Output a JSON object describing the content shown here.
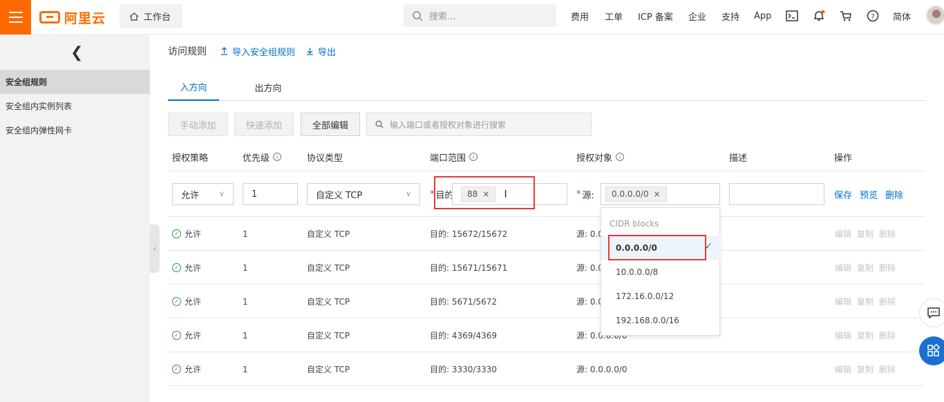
{
  "topbar": {
    "brand": "阿里云",
    "workbench": "工作台",
    "search_placeholder": "搜索...",
    "nav": [
      "费用",
      "工单",
      "ICP 备案",
      "企业",
      "支持",
      "App"
    ],
    "lang": "简体"
  },
  "sidebar": {
    "items": [
      "安全组规则",
      "安全组内实例列表",
      "安全组内弹性网卡"
    ]
  },
  "main": {
    "title": "访问规则",
    "import_link": "导入安全组规则",
    "export_link": "导出",
    "tabs": [
      "入方向",
      "出方向"
    ],
    "buttons": {
      "manual_add": "手动添加",
      "quick_add": "快速添加",
      "batch_edit": "全部编辑"
    },
    "table_search_placeholder": "输入端口或者授权对象进行搜索",
    "columns": [
      "授权策略",
      "优先级",
      "协议类型",
      "端口范围",
      "授权对象",
      "描述",
      "操作"
    ],
    "edit_row": {
      "policy": "允许",
      "priority": "1",
      "protocol": "自定义 TCP",
      "port_label": "目的:",
      "port_tag": "88",
      "source_label": "源:",
      "source_tag": "0.0.0.0/0",
      "save": "保存",
      "preview": "预览",
      "delete": "删除"
    },
    "rows": [
      {
        "policy": "允许",
        "priority": "1",
        "protocol": "自定义 TCP",
        "port": "目的: 15672/15672",
        "source": "源: 0.0.0.0/0"
      },
      {
        "policy": "允许",
        "priority": "1",
        "protocol": "自定义 TCP",
        "port": "目的: 15671/15671",
        "source": "源: 0.0.0.0/0"
      },
      {
        "policy": "允许",
        "priority": "1",
        "protocol": "自定义 TCP",
        "port": "目的: 5671/5672",
        "source": "源: 0.0.0.0/0"
      },
      {
        "policy": "允许",
        "priority": "1",
        "protocol": "自定义 TCP",
        "port": "目的: 4369/4369",
        "source": "源: 0.0.0.0/0"
      },
      {
        "policy": "允许",
        "priority": "1",
        "protocol": "自定义 TCP",
        "port": "目的: 3330/3330",
        "source": "源: 0.0.0.0/0"
      }
    ],
    "row_ops": [
      "编辑",
      "复制",
      "删除"
    ]
  },
  "dropdown": {
    "header": "CIDR blocks",
    "options": [
      "0.0.0.0/0",
      "10.0.0.0/8",
      "172.16.0.0/12",
      "192.168.0.0/16"
    ],
    "selected": "0.0.0.0/0"
  },
  "colors": {
    "brand": "#ff6a00",
    "link": "#0070cc",
    "highlight": "#e53935",
    "allow": "#2c9a3a"
  }
}
